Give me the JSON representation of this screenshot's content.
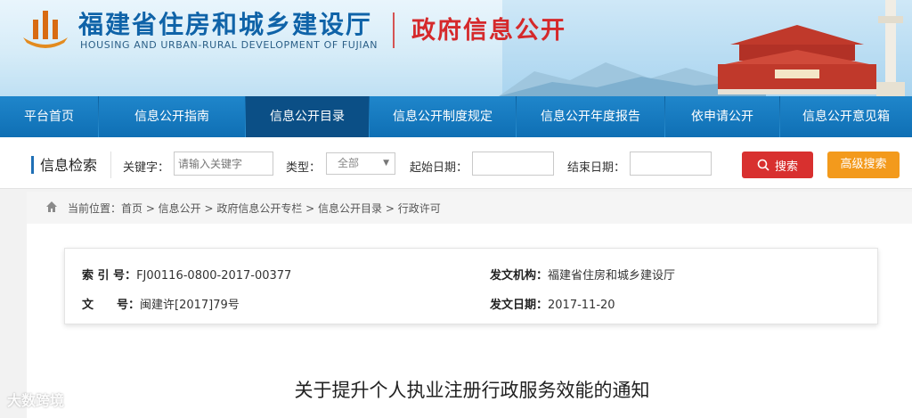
{
  "header": {
    "site_title": "福建省住房和城乡建设厅",
    "site_subtitle": "HOUSING AND URBAN-RURAL DEVELOPMENT OF FUJIAN",
    "section_title": "政府信息公开"
  },
  "nav": {
    "items": [
      {
        "label": "平台首页",
        "active": false
      },
      {
        "label": "信息公开指南",
        "active": false
      },
      {
        "label": "信息公开目录",
        "active": true
      },
      {
        "label": "信息公开制度规定",
        "active": false
      },
      {
        "label": "信息公开年度报告",
        "active": false
      },
      {
        "label": "依申请公开",
        "active": false
      },
      {
        "label": "信息公开意见箱",
        "active": false
      }
    ]
  },
  "search": {
    "title": "信息检索",
    "keyword_label": "关键字：",
    "keyword_placeholder": "请输入关键字",
    "type_label": "类型：",
    "type_value": "全部",
    "start_label": "起始日期：",
    "end_label": "结束日期：",
    "search_button": "搜索",
    "advanced_button": "高级搜索"
  },
  "breadcrumb": {
    "text": "当前位置：首页 > 信息公开 > 政府信息公开专栏 > 信息公开目录 > 行政许可"
  },
  "meta": {
    "index_label": "索 引 号：",
    "index_value": "FJ00116-0800-2017-00377",
    "issuer_label": "发文机构：",
    "issuer_value": "福建省住房和城乡建设厅",
    "docno_label": "文　　号：",
    "docno_value": "闽建许[2017]79号",
    "date_label": "发文日期：",
    "date_value": "2017-11-20"
  },
  "document": {
    "title": "关于提升个人执业注册行政服务效能的通知"
  },
  "watermark": "大数跨境",
  "colors": {
    "nav_blue": "#1577be",
    "nav_active": "#0b4f86",
    "title_red": "#d5292b",
    "search_red": "#d8302f",
    "advanced_orange": "#f39a1c"
  }
}
